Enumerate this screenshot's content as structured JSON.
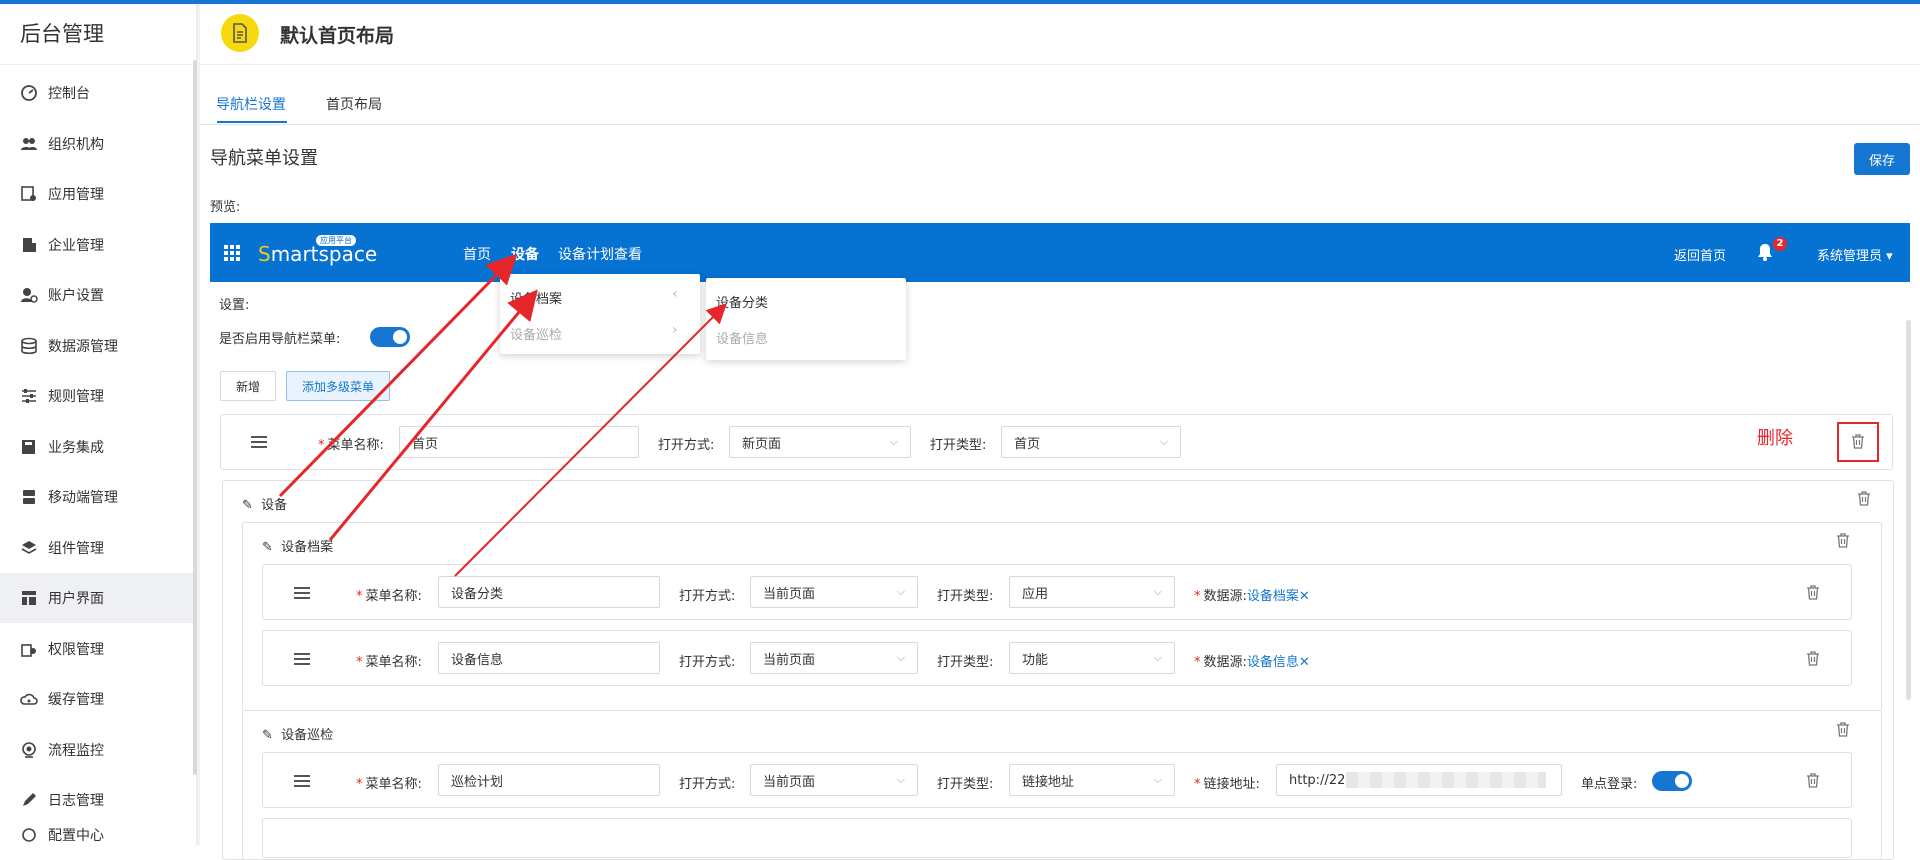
{
  "sidebar": {
    "title": "后台管理",
    "items": [
      {
        "label": "控制台",
        "icon": "dashboard-icon"
      },
      {
        "label": "组织机构",
        "icon": "users-icon"
      },
      {
        "label": "应用管理",
        "icon": "app-settings-icon"
      },
      {
        "label": "企业管理",
        "icon": "building-icon"
      },
      {
        "label": "账户设置",
        "icon": "user-gear-icon"
      },
      {
        "label": "数据源管理",
        "icon": "database-icon"
      },
      {
        "label": "规则管理",
        "icon": "sliders-icon"
      },
      {
        "label": "业务集成",
        "icon": "book-icon"
      },
      {
        "label": "移动端管理",
        "icon": "server-icon"
      },
      {
        "label": "组件管理",
        "icon": "layers-icon"
      },
      {
        "label": "用户界面",
        "icon": "layout-icon"
      },
      {
        "label": "权限管理",
        "icon": "permission-icon"
      },
      {
        "label": "缓存管理",
        "icon": "cloud-icon"
      },
      {
        "label": "流程监控",
        "icon": "camera-icon"
      },
      {
        "label": "日志管理",
        "icon": "pen-icon"
      },
      {
        "label": "配置中心",
        "icon": "config-icon"
      }
    ]
  },
  "header": {
    "title": "默认首页布局"
  },
  "tabs": [
    {
      "label": "导航栏设置"
    },
    {
      "label": "首页布局"
    }
  ],
  "section": {
    "title": "导航菜单设置",
    "save_label": "保存",
    "preview_label": "预览:"
  },
  "preview_nav": {
    "brand_s": "S",
    "brand_rest": "martspace",
    "brand_tag": "应用平台",
    "links": [
      "首页",
      "设备",
      "设备计划查看"
    ],
    "back_home": "返回首页",
    "bell_count": "2",
    "user": "系统管理员"
  },
  "dropdown1": {
    "items": [
      "设备档案",
      "设备巡检"
    ]
  },
  "dropdown2": {
    "items": [
      "设备分类",
      "设备信息"
    ]
  },
  "settings": {
    "label": "设置:",
    "enable_label": "是否启用导航栏菜单:",
    "add_label": "新增",
    "add_multi_label": "添加多级菜单"
  },
  "labels": {
    "menu_name": "菜单名称:",
    "open_mode": "打开方式:",
    "open_type": "打开类型:",
    "datasource": "数据源:",
    "link_addr": "链接地址:",
    "sso": "单点登录:"
  },
  "row_home": {
    "name": "首页",
    "open_mode": "新页面",
    "open_type": "首页"
  },
  "annotation": {
    "delete_label": "删除"
  },
  "group1": {
    "title": "设备"
  },
  "sub1": {
    "title": "设备档案"
  },
  "row_cat": {
    "name": "设备分类",
    "open_mode": "当前页面",
    "open_type": "应用",
    "datasource": "设备档案"
  },
  "row_info": {
    "name": "设备信息",
    "open_mode": "当前页面",
    "open_type": "功能",
    "datasource": "设备信息"
  },
  "sub2": {
    "title": "设备巡检"
  },
  "row_plan": {
    "name": "巡检计划",
    "open_mode": "当前页面",
    "open_type": "链接地址",
    "link": "http://221"
  },
  "colors": {
    "primary": "#1677d2",
    "nav_bg": "#0672d2",
    "danger": "#e5262a",
    "logo": "#f8d90f"
  }
}
